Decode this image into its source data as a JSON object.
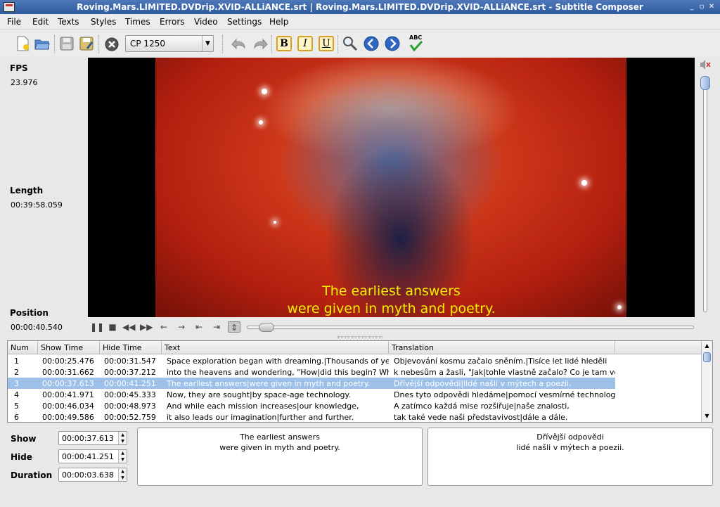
{
  "window": {
    "title": "Roving.Mars.LIMITED.DVDrip.XVID-ALLiANCE.srt | Roving.Mars.LIMITED.DVDrip.XVID-ALLiANCE.srt - Subtitle Composer",
    "minimize": "_",
    "maximize": "▫",
    "close": "✕"
  },
  "menu": [
    "File",
    "Edit",
    "Texts",
    "Styles",
    "Times",
    "Errors",
    "Video",
    "Settings",
    "Help"
  ],
  "toolbar": {
    "codec": "CP 1250",
    "bold_label": "B",
    "italic_label": "I",
    "underline_label": "U",
    "spell_label": "ABC",
    "icons": [
      "new-file-icon",
      "open-file-icon",
      "save-icon",
      "save-as-icon",
      "close-icon",
      "undo-icon",
      "redo-icon",
      "bold-icon",
      "italic-icon",
      "underline-icon",
      "find-icon",
      "previous-icon",
      "next-icon",
      "spell-check-icon"
    ]
  },
  "info": {
    "fps_label": "FPS",
    "fps_value": "23.976",
    "length_label": "Length",
    "length_value": "00:39:58.059",
    "position_label": "Position",
    "position_value": "00:00:40.540"
  },
  "player": {
    "subtitle_line1": "The earliest answers",
    "subtitle_line2": "were given in myth and poetry.",
    "seek_position": 0.017,
    "volume_level": 1.0
  },
  "table": {
    "columns": [
      "Num",
      "Show Time",
      "Hide Time",
      "Text",
      "Translation"
    ],
    "rows": [
      {
        "num": "1",
        "show": "00:00:25.476",
        "hide": "00:00:31.547",
        "text": "Space exploration began with dreaming.|Thousands of years ago",
        "translation": "Objevování kosmu začalo sněním.|Tisíce let lidé hleděli"
      },
      {
        "num": "2",
        "show": "00:00:31.662",
        "hide": "00:00:37.212",
        "text": "into the heavens and wondering, \"How|did this begin? What's out there?\"",
        "translation": "k nebesům a žasli, \"Jak|tohle vlastně začalo? Co je tam venku?\""
      },
      {
        "num": "3",
        "show": "00:00:37.613",
        "hide": "00:00:41.251",
        "text": "The earliest answers|were given in myth and poetry.",
        "translation": "Dřívější odpovědi|lidé našli v mýtech a poezii."
      },
      {
        "num": "4",
        "show": "00:00:41.971",
        "hide": "00:00:45.333",
        "text": "Now, they are sought|by space-age technology.",
        "translation": "Dnes tyto odpovědi hledáme|pomocí vesmírné technologie."
      },
      {
        "num": "5",
        "show": "00:00:46.034",
        "hide": "00:00:48.973",
        "text": "And while each mission increases|our knowledge,",
        "translation": "A zatímco každá mise rozšiřuje|naše znalosti,"
      },
      {
        "num": "6",
        "show": "00:00:49.586",
        "hide": "00:00:52.759",
        "text": "it also leads our imagination|further and further.",
        "translation": "tak také vede naši představivost|dále a dále."
      }
    ],
    "selected_row": 2
  },
  "editor": {
    "show_label": "Show",
    "show_value": "00:00:37.613",
    "hide_label": "Hide",
    "hide_value": "00:00:41.251",
    "duration_label": "Duration",
    "duration_value": "00:00:03.638",
    "text_line1": "The earliest answers",
    "text_line2": "were given in myth and poetry.",
    "translation_line1": "Dřívější odpovědi",
    "translation_line2": "lidé našli v mýtech a poezii."
  }
}
